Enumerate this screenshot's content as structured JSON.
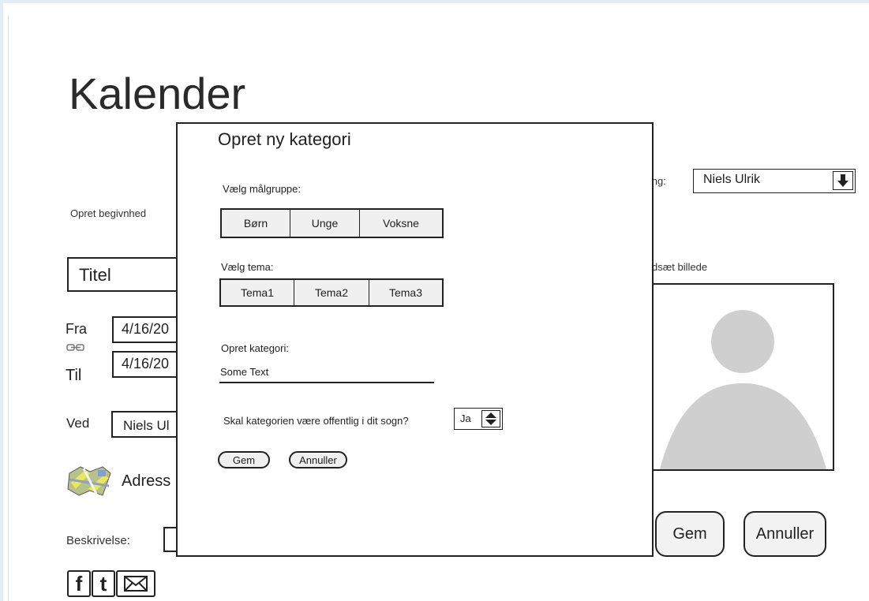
{
  "page": {
    "title": "Kalender",
    "create_event_label": "Opret begivnhed",
    "owner_label": "tning:",
    "owner_value": "Niels Ulrik",
    "title_placeholder": "Titel",
    "from_label": "Fra",
    "from_value": "4/16/20",
    "to_label": "Til",
    "to_value": "4/16/20",
    "at_label": "Ved",
    "at_value": "Niels Ul",
    "address_label": "Adress",
    "description_label": "Beskrivelse:",
    "insert_image_label": "dsæt billede",
    "save_button": "Gem",
    "cancel_button": "Annuller",
    "social": [
      "f",
      "t",
      "✉"
    ]
  },
  "modal": {
    "title": "Opret ny kategori",
    "audience_label": "Vælg målgruppe:",
    "audience_options": [
      "Børn",
      "Unge",
      "Voksne"
    ],
    "theme_label": "Vælg tema:",
    "theme_options": [
      "Tema1",
      "Tema2",
      "Tema3"
    ],
    "create_category_label": "Opret kategori:",
    "create_category_value": "Some Text",
    "public_question": "Skal kategorien være offentlig i dit sogn?",
    "public_value": "Ja",
    "save_button": "Gem",
    "cancel_button": "Annuller"
  },
  "icons": {
    "dropdown": "arrow-down-icon",
    "stepper": "up-down-arrows-icon",
    "link": "link-icon",
    "map": "map-icon",
    "avatar": "person-placeholder-icon",
    "facebook": "facebook-icon",
    "twitter": "twitter-icon",
    "mail": "mail-icon"
  },
  "colors": {
    "frame": "#e4edf5",
    "placeholder_grey": "#cfcfcf",
    "border": "#222222"
  }
}
